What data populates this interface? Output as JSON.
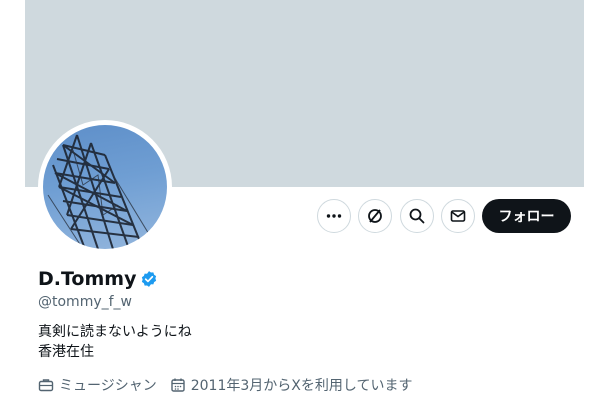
{
  "profile": {
    "display_name": "D.Tommy",
    "handle": "@tommy_f_w",
    "bio_lines": [
      "真剣に読まないようにね",
      "香港在住"
    ],
    "profession": "ミュージシャン",
    "joined": "2011年3月からXを利用しています",
    "verified": true
  },
  "actions": {
    "more_icon": "more-horizontal-icon",
    "grok_icon": "grok-icon",
    "search_icon": "search-icon",
    "message_icon": "envelope-icon",
    "follow_label": "フォロー"
  },
  "colors": {
    "banner": "#cfd9de",
    "verified": "#1d9bf0",
    "follow_bg": "#0f1419",
    "secondary_text": "#536471"
  }
}
